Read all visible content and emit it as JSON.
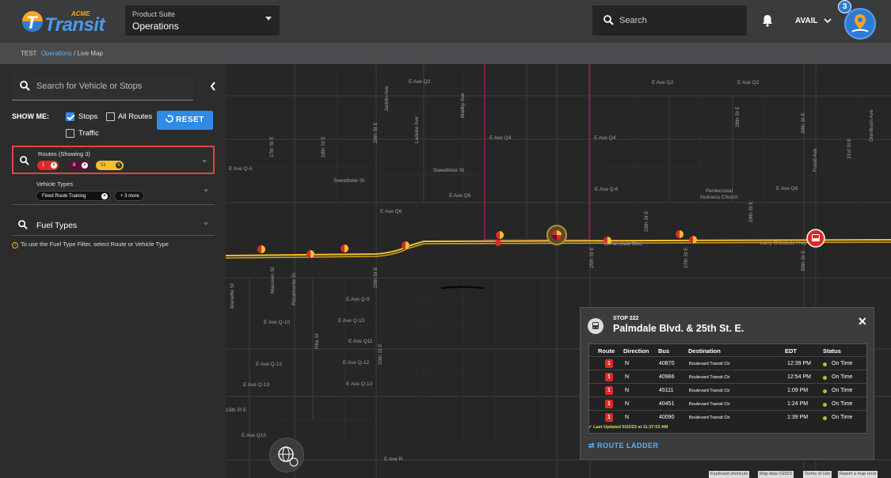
{
  "header": {
    "logo": {
      "acme": "ACME",
      "word": "Transit"
    },
    "suite": {
      "label": "Product Suite",
      "value": "Operations"
    },
    "search_placeholder": "Search",
    "user_label": "AVAIL",
    "notification_count": "3"
  },
  "breadcrumb": {
    "env": "TEST",
    "parent": "Operations",
    "separator": "/",
    "current": "Live Map"
  },
  "sidebar": {
    "search_placeholder": "Search for Vehicle or Stops",
    "show_me": "SHOW ME:",
    "stops": "Stops",
    "all_routes": "All Routes",
    "traffic": "Traffic",
    "reset": "RESET",
    "routes_title": "Routes (Showing 3)",
    "route_chips": [
      "1",
      "8",
      "51"
    ],
    "vehicle_title": "Vehicle Types",
    "vehicle_chip": "Fixed Route Training",
    "vehicle_more": "+ 3 more",
    "fuel_title": "Fuel Types",
    "fuel_note": "To use the Fuel Type Filter, select Route or Vehicle Type"
  },
  "map": {
    "streets": {
      "e_ave_q2": "E Ave Q2",
      "e_ave_q2b": "E Ave Q2",
      "e_ave_q4": "E Ave Q4",
      "e_ave_q4b": "E Ave Q4",
      "e_ave_q5": "E Ave Q-5",
      "e_ave_q6": "E Ave Q6",
      "e_ave_q6b": "E Ave Q6",
      "e_ave_q6c": "E Ave Q-6",
      "e_ave_q6d": "E Ave Q6",
      "sweetbrier_w": "Sweetbrier St",
      "sweetbrier_e": "Sweetbrier St",
      "palmdale": "E Palmdale Blvd",
      "larry": "Larry Chimbole Hwy",
      "e_ave_q9": "E Ave Q-9",
      "e_ave_q10": "E Ave Q-10",
      "e_ave_q10b": "E Ave Q-10",
      "e_ave_q11": "E Ave Q11",
      "e_ave_q12": "E Ave Q-12",
      "e_ave_q12b": "E Ave Q-12",
      "e_ave_q13": "E Ave Q-13",
      "e_ave_q13b": "E Ave Q-13",
      "e_ave_q15": "E Ave Q15",
      "e_ave_r": "E Ave R",
      "fifteenth_pl": "15th Pl E",
      "st17": "17th St E",
      "st18": "18th St E",
      "st20": "20th St E",
      "st20b": "20th St E",
      "st20c": "20th St E",
      "st25": "25th St E",
      "st26": "26th St E",
      "st27": "27th St E",
      "st30": "30th St E",
      "st30b": "30th St E",
      "st31": "31st St E",
      "st29": "29th St E",
      "st28": "28th St E",
      "jacklin": "Jacklin Ave",
      "laduke": "Laduke Ave",
      "maltby": "Maltby Ave",
      "rosamonte": "Rosamonte St",
      "maureen": "Maureen St",
      "jeanette": "Jeanette St",
      "rita": "Rita St",
      "glenbush": "Glenbush Ave",
      "fossil": "Fossil Ave",
      "church": "Pentecostal Holiness Church"
    },
    "attribution": [
      "Keyboard shortcuts",
      "Map data ©2023",
      "Terms of Use",
      "Report a map error"
    ]
  },
  "popup": {
    "stop_number": "STOP 222",
    "stop_name": "Palmdale Blvd. & 25th St. E.",
    "columns": [
      "Route",
      "Direction",
      "Bus",
      "Destination",
      "EDT",
      "Status"
    ],
    "rows": [
      {
        "route": "1",
        "direction": "N",
        "bus": "40870",
        "destination": "Boulevard Transit Ctr",
        "edt": "12:39 PM",
        "status": "On Time"
      },
      {
        "route": "1",
        "direction": "N",
        "bus": "40986",
        "destination": "Boulevard Transit Ctr",
        "edt": "12:54 PM",
        "status": "On Time"
      },
      {
        "route": "1",
        "direction": "N",
        "bus": "45111",
        "destination": "Boulevard Transit Ctr",
        "edt": "1:09 PM",
        "status": "On Time"
      },
      {
        "route": "1",
        "direction": "N",
        "bus": "40451",
        "destination": "Boulevard Transit Ctr",
        "edt": "1:24 PM",
        "status": "On Time"
      },
      {
        "route": "1",
        "direction": "N",
        "bus": "40090",
        "destination": "Boulevard Transit Ctr",
        "edt": "1:39 PM",
        "status": "On Time"
      }
    ],
    "updated": "Last Updated 5/22/23 at 11:37:53 AM",
    "ladder": "ROUTE LADDER"
  },
  "colors": {
    "accent": "#2e8be6",
    "route1": "#e02828",
    "route8": "#5a1038",
    "route51": "#f2c12e",
    "ontime": "#9ccc2e",
    "route_line": "#f2c12e"
  }
}
